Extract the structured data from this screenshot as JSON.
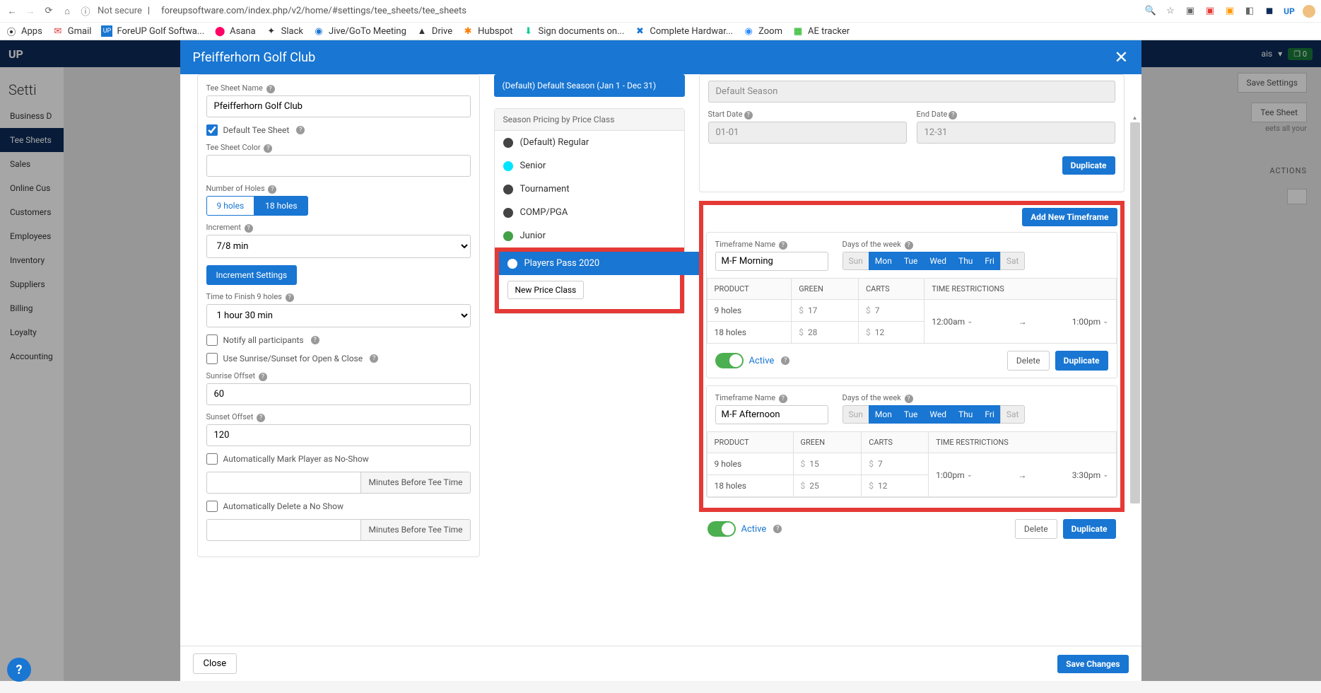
{
  "browser": {
    "url": "foreupsoftware.com/index.php/v2/home/#settings/tee_sheets/tee_sheets",
    "not_secure": "Not secure",
    "bookmarks": [
      "Apps",
      "Gmail",
      "ForeUP Golf Softwa...",
      "Asana",
      "Slack",
      "Jive/GoTo Meeting",
      "Drive",
      "Hubspot",
      "Sign documents on...",
      "Complete Hardwar...",
      "Zoom",
      "AE tracker"
    ]
  },
  "app": {
    "title_truncated": "ais",
    "badge": "0",
    "save_settings": "Save Settings",
    "tee_sheet_tag": "Tee Sheet",
    "desc": "eets all your",
    "actions": "ACTIONS"
  },
  "modal": {
    "title": "Pfeifferhorn Golf Club",
    "close_label": "Close",
    "save_changes": "Save Changes"
  },
  "sidebar": {
    "title": "Setti",
    "items": [
      "Business D",
      "Tee Sheets",
      "Sales",
      "Online Cus",
      "Customers",
      "Employees",
      "Inventory",
      "Suppliers",
      "Billing",
      "Loyalty",
      "Accounting"
    ]
  },
  "left": {
    "tee_sheet_name_label": "Tee Sheet Name",
    "tee_sheet_name_value": "Pfeifferhorn Golf Club",
    "default_tee_sheet": "Default Tee Sheet",
    "tee_sheet_color_label": "Tee Sheet Color",
    "number_of_holes_label": "Number of Holes",
    "holes9": "9 holes",
    "holes18": "18 holes",
    "increment_label": "Increment",
    "increment_value": "7/8 min",
    "increment_settings": "Increment Settings",
    "time_to_finish_label": "Time to Finish 9 holes",
    "time_to_finish_value": "1 hour 30 min",
    "notify": "Notify all participants",
    "sunrise_sunset": "Use Sunrise/Sunset for Open & Close",
    "sunrise_offset_label": "Sunrise Offset",
    "sunrise_offset_value": "60",
    "sunset_offset_label": "Sunset Offset",
    "sunset_offset_value": "120",
    "auto_noshow": "Automatically Mark Player as No-Show",
    "minutes_before": "Minutes Before Tee Time",
    "auto_delete": "Automatically Delete a No Show"
  },
  "mid": {
    "season_banner": "(Default) Default Season (Jan 1 - Dec 31)",
    "section_label": "Season Pricing by Price Class",
    "classes": [
      {
        "name": "(Default) Regular",
        "color": "#444"
      },
      {
        "name": "Senior",
        "color": "#00e5ff"
      },
      {
        "name": "Tournament",
        "color": "#444"
      },
      {
        "name": "COMP/PGA",
        "color": "#444"
      },
      {
        "name": "Junior",
        "color": "#43a047"
      },
      {
        "name": "Players Pass 2020",
        "color": "#fff"
      }
    ],
    "new_price_class": "New Price Class"
  },
  "right": {
    "disabled_value": "Default Season",
    "start_date_label": "Start Date",
    "start_date_value": "01-01",
    "end_date_label": "End Date",
    "end_date_value": "12-31",
    "duplicate": "Duplicate",
    "add_timeframe": "Add New Timeframe",
    "timeframe_name_label": "Timeframe Name",
    "days_label": "Days of the week",
    "days": [
      "Sun",
      "Mon",
      "Tue",
      "Wed",
      "Thu",
      "Fri",
      "Sat"
    ],
    "table": {
      "product": "PRODUCT",
      "green": "GREEN",
      "carts": "CARTS",
      "time": "TIME RESTRICTIONS"
    },
    "timeframes": [
      {
        "name": "M-F Morning",
        "days_on": [
          false,
          true,
          true,
          true,
          true,
          true,
          false
        ],
        "rows": [
          {
            "product": "9 holes",
            "green": "17",
            "carts": "7"
          },
          {
            "product": "18 holes",
            "green": "28",
            "carts": "12"
          }
        ],
        "time_from": "12:00am",
        "time_to": "1:00pm",
        "active_label": "Active",
        "delete": "Delete",
        "duplicate": "Duplicate"
      },
      {
        "name": "M-F Afternoon",
        "days_on": [
          false,
          true,
          true,
          true,
          true,
          true,
          false
        ],
        "rows": [
          {
            "product": "9 holes",
            "green": "15",
            "carts": "7"
          },
          {
            "product": "18 holes",
            "green": "25",
            "carts": "12"
          }
        ],
        "time_from": "1:00pm",
        "time_to": "3:30pm",
        "active_label": "Active",
        "delete": "Delete",
        "duplicate": "Duplicate"
      }
    ]
  }
}
